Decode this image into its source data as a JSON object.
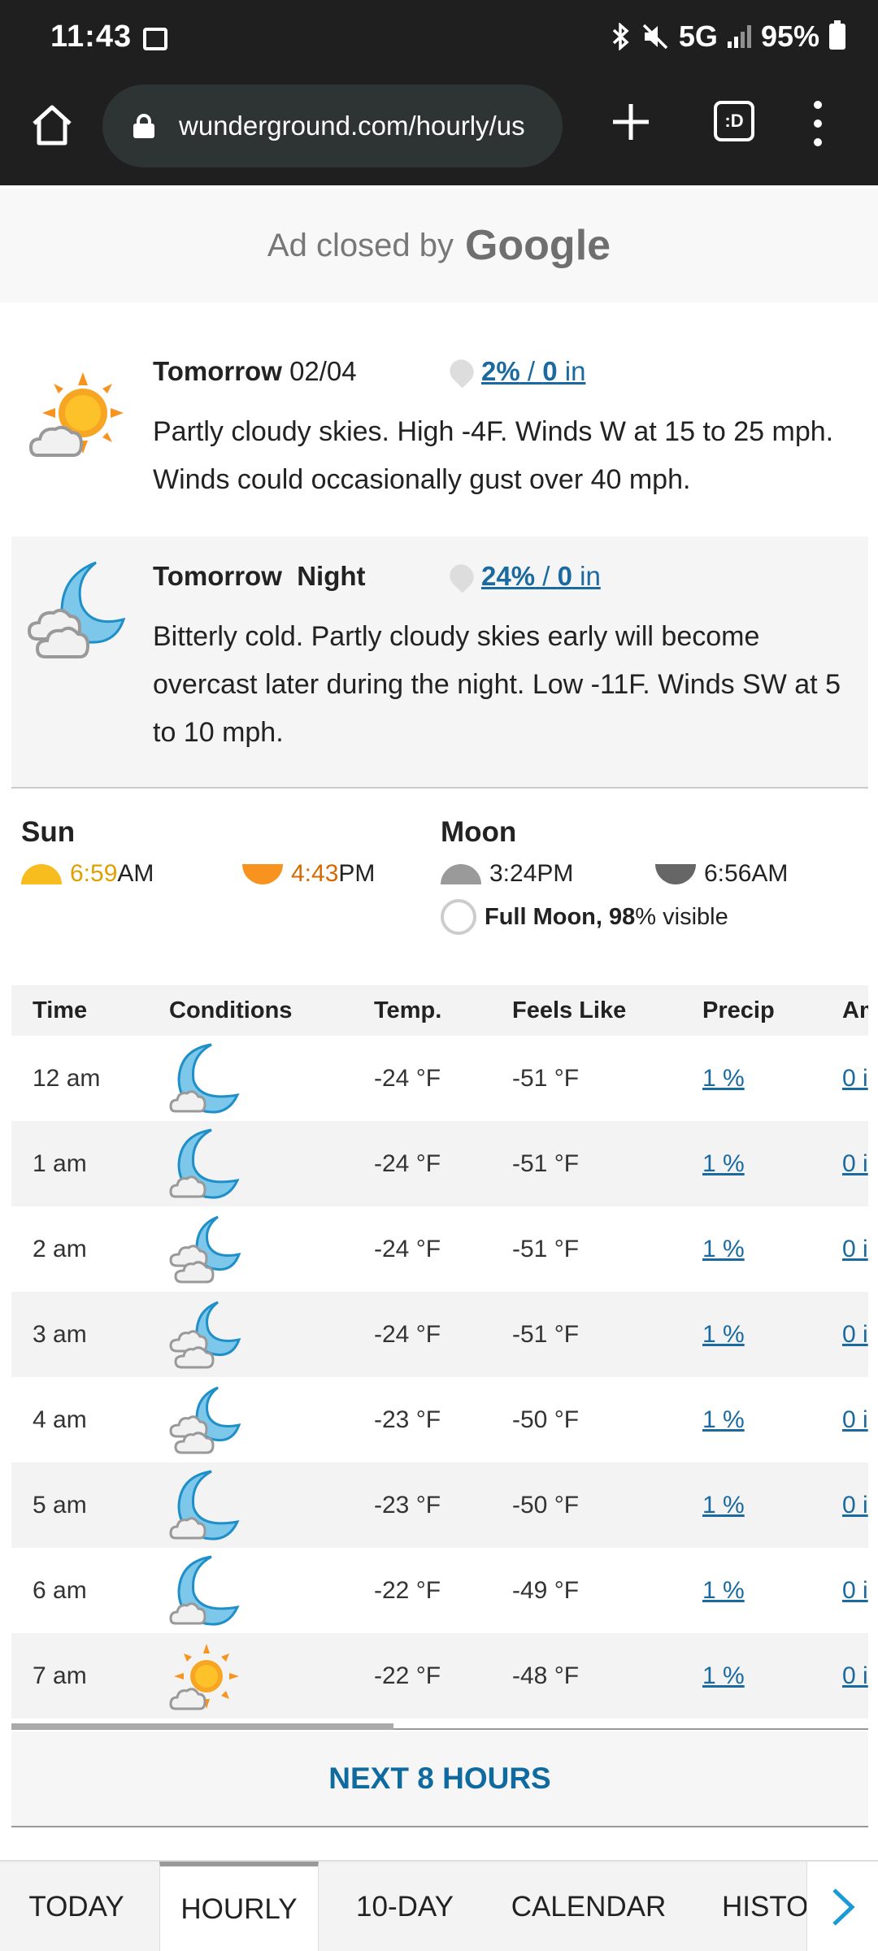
{
  "status_bar": {
    "time": "11:43",
    "network": "5G",
    "battery": "95%",
    "icons": [
      "gallery-icon",
      "bluetooth-icon",
      "mute-icon",
      "signal-icon",
      "battery-icon"
    ]
  },
  "browser": {
    "url": "wunderground.com/hourly/us",
    "tabs_label": ":D"
  },
  "ad": {
    "closed_by": "Ad closed by",
    "brand": "Google"
  },
  "forecast_day": {
    "title_bold": "Tomorrow",
    "date": "02/04",
    "precip_pct": "2%",
    "precip_sep": " / ",
    "precip_amt": "0",
    "precip_unit": " in",
    "text": "Partly cloudy skies. High -4F. Winds W at 15 to 25 mph. Winds could occasionally gust over 40 mph.",
    "icon": "partly-cloudy-day-icon"
  },
  "forecast_night": {
    "title_bold": "Tomorrow  Night",
    "precip_pct": "24%",
    "precip_sep": " / ",
    "precip_amt": "0",
    "precip_unit": " in",
    "text": "Bitterly cold. Partly cloudy skies early will become overcast later during the night. Low -11F. Winds SW at 5 to 10 mph.",
    "icon": "partly-cloudy-night-icon"
  },
  "sun": {
    "label": "Sun",
    "rise_time": "6:59",
    "rise_suffix": "AM",
    "set_time": "4:43",
    "set_suffix": "PM",
    "rise_color": "#f0b429",
    "set_color": "#e07b10"
  },
  "moon": {
    "label": "Moon",
    "rise": "3:24PM",
    "set": "6:56AM",
    "phase_bold": "Full Moon,",
    "phase_pct": "98",
    "phase_rest": "% visible"
  },
  "table": {
    "columns": [
      "Time",
      "Conditions",
      "Temp.",
      "Feels Like",
      "Precip",
      "Am"
    ],
    "rows": [
      {
        "time": "12 am",
        "icon": "moon-cloud-icon",
        "temp": "-24 °F",
        "feels": "-51 °F",
        "precip": "1 %",
        "amount": "0 i"
      },
      {
        "time": "1 am",
        "icon": "moon-cloud-icon",
        "temp": "-24 °F",
        "feels": "-51 °F",
        "precip": "1 %",
        "amount": "0 i"
      },
      {
        "time": "2 am",
        "icon": "moon-clouds-icon",
        "temp": "-24 °F",
        "feels": "-51 °F",
        "precip": "1 %",
        "amount": "0 i"
      },
      {
        "time": "3 am",
        "icon": "moon-clouds-icon",
        "temp": "-24 °F",
        "feels": "-51 °F",
        "precip": "1 %",
        "amount": "0 i"
      },
      {
        "time": "4 am",
        "icon": "moon-clouds-icon",
        "temp": "-23 °F",
        "feels": "-50 °F",
        "precip": "1 %",
        "amount": "0 i"
      },
      {
        "time": "5 am",
        "icon": "moon-cloud-icon",
        "temp": "-23 °F",
        "feels": "-50 °F",
        "precip": "1 %",
        "amount": "0 i"
      },
      {
        "time": "6 am",
        "icon": "moon-cloud-icon",
        "temp": "-22 °F",
        "feels": "-49 °F",
        "precip": "1 %",
        "amount": "0 i"
      },
      {
        "time": "7 am",
        "icon": "sun-cloud-icon",
        "temp": "-22 °F",
        "feels": "-48 °F",
        "precip": "1 %",
        "amount": "0 i"
      }
    ]
  },
  "next_button": "NEXT 8 HOURS",
  "bottom_nav": {
    "tabs": [
      "TODAY",
      "HOURLY",
      "10-DAY",
      "CALENDAR",
      "HISTO"
    ],
    "active": "HOURLY"
  },
  "colors": {
    "link": "#1a6aa0",
    "sun": "#f7a623",
    "moon": "#7cc7ea"
  }
}
